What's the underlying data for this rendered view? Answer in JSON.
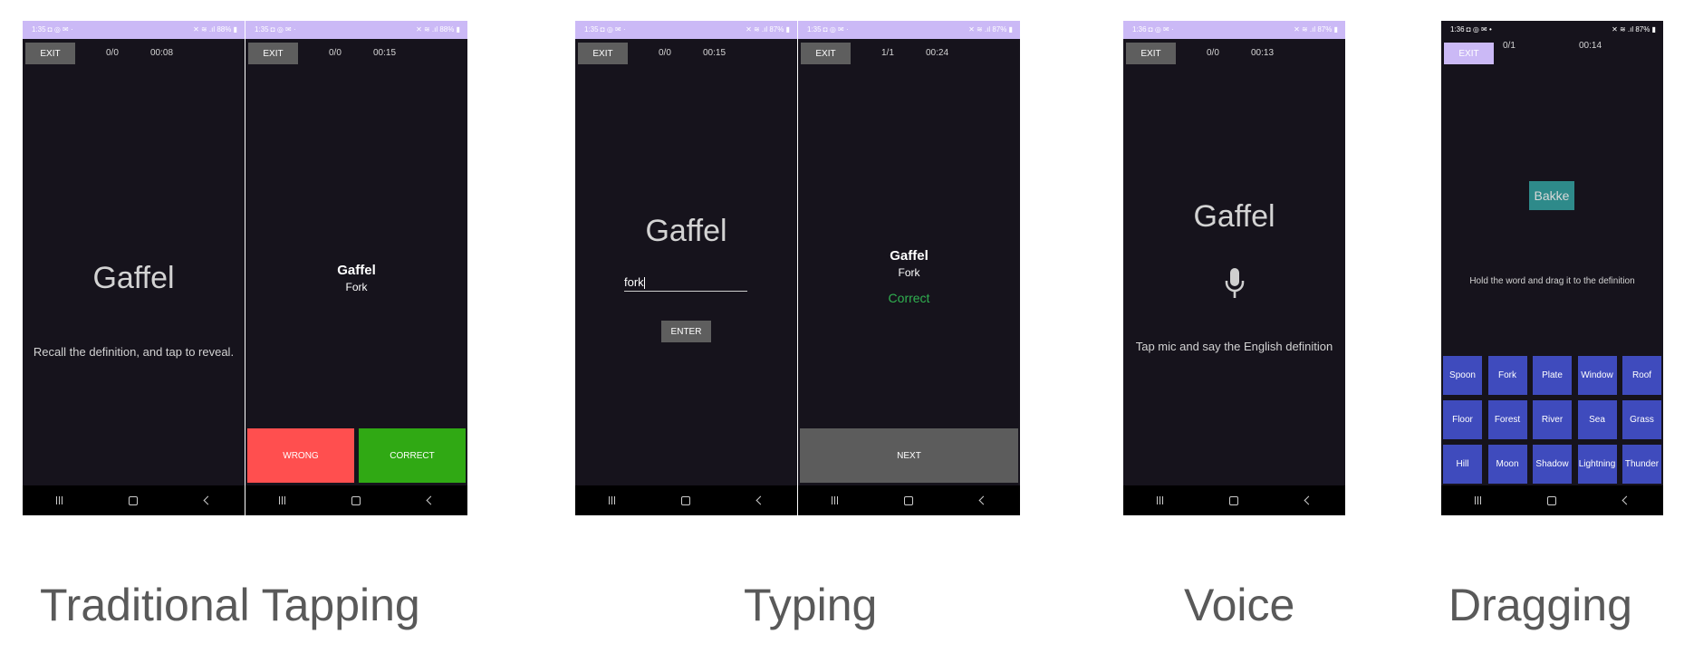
{
  "status": {
    "purple_left": "1:35 ◘ ◎ ✉ ·",
    "purple_right": "✕ ≋ .ıl 88% ▮",
    "typing_right": "✕ ≋ .ıl 87% ▮",
    "voice_left": "1:36 ◘ ◎ ✉ ·",
    "drag_left": "1:36 ◘ ◎ ✉ •",
    "drag_right": "✕ ≋ .ıl 87% ▮"
  },
  "exit_label": "EXIT",
  "screens": {
    "recall": {
      "score": "0/0",
      "time": "00:08",
      "word": "Gaffel",
      "hint": "Recall the definition, and tap to reveal."
    },
    "reveal": {
      "score": "0/0",
      "time": "00:15",
      "word": "Gaffel",
      "definition": "Fork",
      "wrong_label": "WRONG",
      "correct_label": "CORRECT"
    },
    "typing": {
      "score": "0/0",
      "time": "00:15",
      "word": "Gaffel",
      "typed_value": "fork",
      "enter_label": "ENTER"
    },
    "typing_result": {
      "score": "1/1",
      "time": "00:24",
      "word": "Gaffel",
      "definition": "Fork",
      "result": "Correct",
      "next_label": "NEXT"
    },
    "voice": {
      "score": "0/0",
      "time": "00:13",
      "word": "Gaffel",
      "hint": "Tap mic and say the English definition"
    },
    "dragging": {
      "score": "0/1",
      "time": "00:14",
      "word": "Bakke",
      "hint": "Hold the word and drag it to the definition",
      "tiles": [
        "Spoon",
        "Fork",
        "Plate",
        "Window",
        "Roof",
        "Floor",
        "Forest",
        "River",
        "Sea",
        "Grass",
        "Hill",
        "Moon",
        "Shadow",
        "Lightning",
        "Thunder"
      ]
    }
  },
  "captions": {
    "tapping": "Traditional Tapping",
    "typing": "Typing",
    "voice": "Voice",
    "dragging": "Dragging"
  },
  "colors": {
    "status_bar": "#cbb9f6",
    "screen_bg": "#16131c",
    "wrong": "#ff4f4f",
    "correct": "#30a914",
    "correct_text": "#30b050",
    "tile": "#3f4bbd",
    "drag_word": "#2e8a8a"
  },
  "icons": [
    "microphone-icon",
    "nav-recent-icon",
    "nav-home-icon",
    "nav-back-icon"
  ]
}
